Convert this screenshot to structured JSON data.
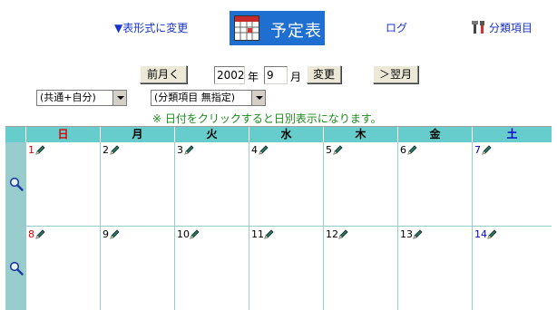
{
  "header": {
    "toggle_view": "▼表形式に変更",
    "title": "予定表",
    "log": "ログ",
    "category": "分類項目"
  },
  "nav": {
    "prev_label": "前月く",
    "year_value": "2002",
    "year_unit": "年",
    "month_value": "9",
    "month_unit": "月",
    "change_label": "変更",
    "next_label": "＞翌月"
  },
  "filters": {
    "owner_selected": "(共通+自分)",
    "category_selected": "(分類項目 無指定)"
  },
  "notice": "※ 日付をクリックすると日別表示になります。",
  "calendar": {
    "weekdays": [
      "日",
      "月",
      "火",
      "水",
      "木",
      "金",
      "土"
    ],
    "weekday_colors": [
      "#dd0000",
      "#000000",
      "#000000",
      "#000000",
      "#000000",
      "#000000",
      "#0000cc"
    ],
    "weeks": [
      [
        "1",
        "2",
        "3",
        "4",
        "5",
        "6",
        "7"
      ],
      [
        "8",
        "9",
        "10",
        "11",
        "12",
        "13",
        "14"
      ]
    ]
  },
  "colors": {
    "title_bg": "#1f6fd1",
    "header_row": "#66cccc",
    "side_column": "#99cccc",
    "notice_text": "#1a8a1a",
    "link": "#1a33cc"
  },
  "icons": {
    "week_view": "magnifier-icon",
    "add_entry": "pencil-icon",
    "title": "calendar-icon",
    "category": "tools-icon"
  }
}
